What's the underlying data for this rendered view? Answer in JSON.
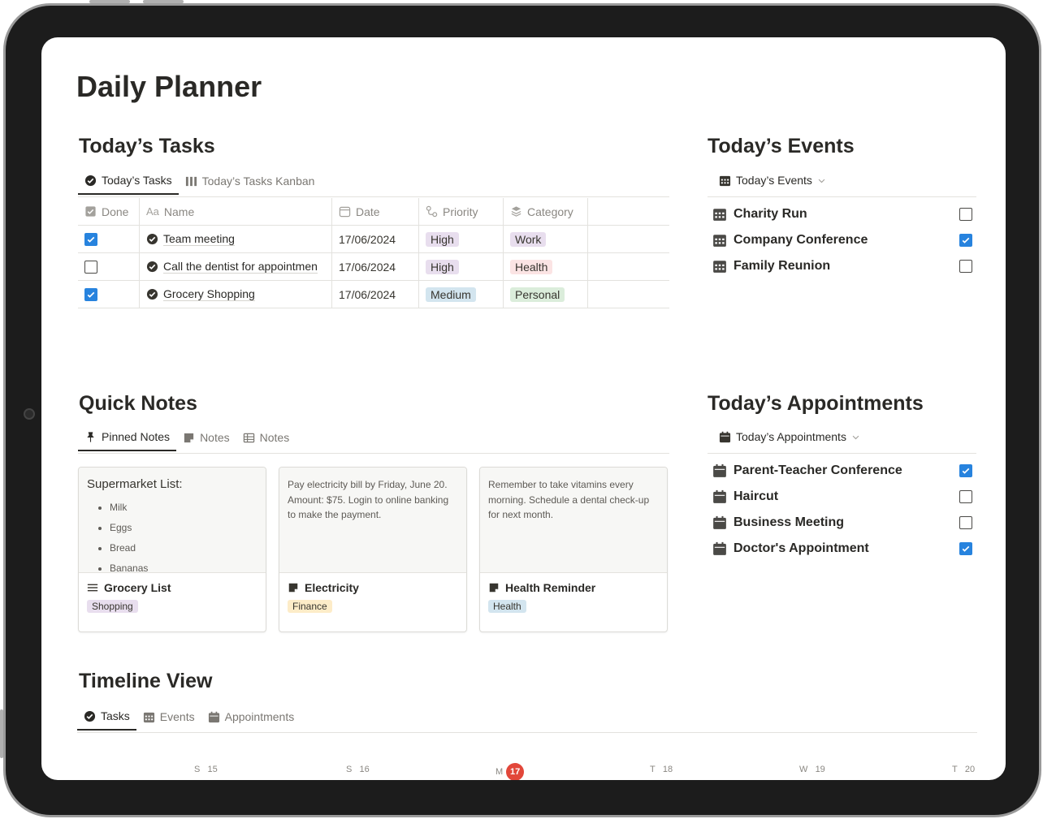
{
  "page": {
    "title": "Daily Planner"
  },
  "tasks": {
    "title": "Today’s Tasks",
    "tabs": [
      "Today’s Tasks",
      "Today’s Tasks Kanban"
    ],
    "columns": {
      "done": "Done",
      "name": "Name",
      "date": "Date",
      "priority": "Priority",
      "category": "Category"
    },
    "rows": [
      {
        "done": true,
        "name": "Team meeting",
        "date": "17/06/2024",
        "priority": "High",
        "category": "Work"
      },
      {
        "done": false,
        "name": "Call the dentist for appointmen",
        "date": "17/06/2024",
        "priority": "High",
        "category": "Health"
      },
      {
        "done": true,
        "name": "Grocery Shopping",
        "date": "17/06/2024",
        "priority": "Medium",
        "category": "Personal"
      }
    ]
  },
  "events": {
    "title": "Today’s Events",
    "view": "Today’s Events",
    "items": [
      {
        "label": "Charity Run",
        "checked": false
      },
      {
        "label": "Company Conference",
        "checked": true
      },
      {
        "label": "Family Reunion",
        "checked": false
      }
    ]
  },
  "notes": {
    "title": "Quick Notes",
    "tabs": [
      "Pinned Notes",
      "Notes",
      "Notes"
    ],
    "cards": [
      {
        "preview_heading": "Supermarket List:",
        "preview_items": [
          "Milk",
          "Eggs",
          "Bread",
          "Bananas"
        ],
        "title": "Grocery List",
        "tag": "Shopping"
      },
      {
        "preview_text": "Pay electricity bill by Friday, June 20. Amount: $75. Login to online banking to make the payment.",
        "title": "Electricity",
        "tag": "Finance"
      },
      {
        "preview_text": "Remember to take vitamins every morning. Schedule a dental check-up for next month.",
        "title": "Health Reminder",
        "tag": "Health"
      }
    ]
  },
  "appointments": {
    "title": "Today’s Appointments",
    "view": "Today’s Appointments",
    "items": [
      {
        "label": "Parent-Teacher Conference",
        "checked": true
      },
      {
        "label": "Haircut",
        "checked": false
      },
      {
        "label": "Business Meeting",
        "checked": false
      },
      {
        "label": "Doctor's Appointment",
        "checked": true
      }
    ]
  },
  "timeline": {
    "title": "Timeline View",
    "tabs": [
      "Tasks",
      "Events",
      "Appointments"
    ],
    "days": [
      {
        "dow": "S",
        "num": "15"
      },
      {
        "dow": "S",
        "num": "16"
      },
      {
        "dow": "M",
        "num": "17"
      },
      {
        "dow": "T",
        "num": "18"
      },
      {
        "dow": "W",
        "num": "19"
      },
      {
        "dow": "T",
        "num": "20"
      }
    ]
  },
  "colors": {
    "check_blue": "#2783de",
    "tag_purple": "#e8deee",
    "tag_red": "#fbe4e4",
    "tag_blue": "#d3e5ef",
    "tag_green": "#dbeddb",
    "tag_orange": "#fdecc8",
    "today_red": "#e2473a"
  }
}
